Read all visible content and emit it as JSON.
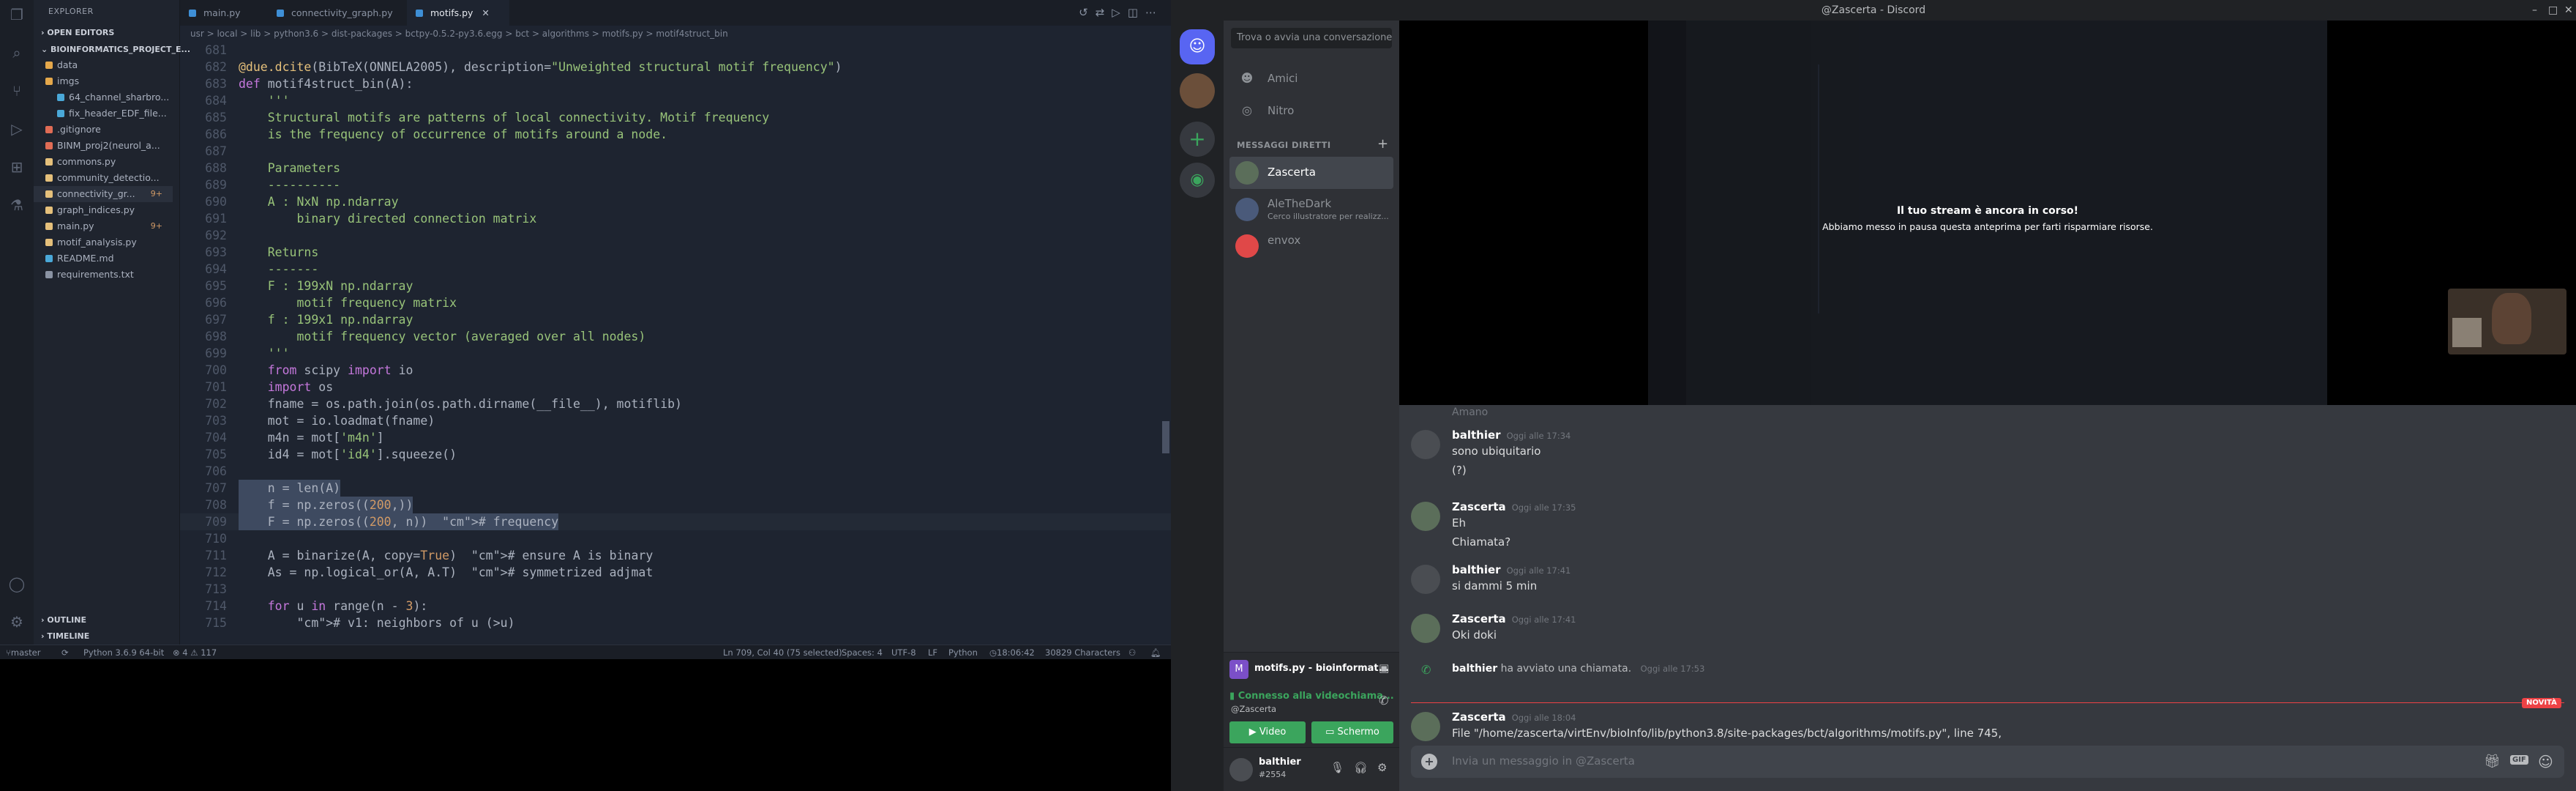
{
  "vscode": {
    "explorer_title": "EXPLORER",
    "open_editors": "OPEN EDITORS",
    "project": "BIOINFORMATICS_PROJECT_E...",
    "tree": [
      {
        "label": "data",
        "type": "folder",
        "color": "#e5a84b",
        "indent": 1,
        "badge": ""
      },
      {
        "label": "imgs",
        "type": "folder",
        "color": "#e5a84b",
        "indent": 1,
        "badge": ""
      },
      {
        "label": "64_channel_sharbro...",
        "type": "file",
        "color": "#4aa8d8",
        "indent": 2,
        "badge": ""
      },
      {
        "label": "fix_header_EDF_file...",
        "type": "file",
        "color": "#4aa8d8",
        "indent": 2,
        "badge": ""
      },
      {
        "label": ".gitignore",
        "type": "file",
        "color": "#e06c55",
        "indent": 1,
        "badge": ""
      },
      {
        "label": "BINM_proj2(neurol_a...",
        "type": "file",
        "color": "#e06c55",
        "indent": 1,
        "badge": ""
      },
      {
        "label": "commons.py",
        "type": "file",
        "color": "#e5c07b",
        "indent": 1,
        "badge": ""
      },
      {
        "label": "community_detectio...",
        "type": "file",
        "color": "#e5c07b",
        "indent": 1,
        "badge": ""
      },
      {
        "label": "connectivity_gr...",
        "type": "file",
        "color": "#e5c07b",
        "indent": 1,
        "badge": "9+",
        "sel": true
      },
      {
        "label": "graph_indices.py",
        "type": "file",
        "color": "#e5c07b",
        "indent": 1,
        "badge": ""
      },
      {
        "label": "main.py",
        "type": "file",
        "color": "#e5c07b",
        "indent": 1,
        "badge": "9+"
      },
      {
        "label": "motif_analysis.py",
        "type": "file",
        "color": "#e5c07b",
        "indent": 1,
        "badge": ""
      },
      {
        "label": "README.md",
        "type": "file",
        "color": "#4aa8d8",
        "indent": 1,
        "badge": ""
      },
      {
        "label": "requirements.txt",
        "type": "file",
        "color": "#8a93a3",
        "indent": 1,
        "badge": ""
      }
    ],
    "outline": "OUTLINE",
    "timeline": "TIMELINE",
    "tabs": [
      {
        "label": "main.py",
        "active": false
      },
      {
        "label": "connectivity_graph.py",
        "active": false
      },
      {
        "label": "motifs.py",
        "active": true
      }
    ],
    "breadcrumb": "usr > local > lib > python3.6 > dist-packages > bctpy-0.5.2-py3.6.egg > bct > algorithms > motifs.py > motif4struct_bin",
    "code_lines": [
      {
        "n": "681",
        "t": ""
      },
      {
        "n": "682",
        "t": "@due.dcite(BibTeX(ONNELA2005), description=\"Unweighted structural motif frequency\")"
      },
      {
        "n": "683",
        "t": "def motif4struct_bin(A):"
      },
      {
        "n": "684",
        "t": "    '''"
      },
      {
        "n": "685",
        "t": "    Structural motifs are patterns of local connectivity. Motif frequency"
      },
      {
        "n": "686",
        "t": "    is the frequency of occurrence of motifs around a node."
      },
      {
        "n": "687",
        "t": ""
      },
      {
        "n": "688",
        "t": "    Parameters"
      },
      {
        "n": "689",
        "t": "    ----------"
      },
      {
        "n": "690",
        "t": "    A : NxN np.ndarray"
      },
      {
        "n": "691",
        "t": "        binary directed connection matrix"
      },
      {
        "n": "692",
        "t": ""
      },
      {
        "n": "693",
        "t": "    Returns"
      },
      {
        "n": "694",
        "t": "    -------"
      },
      {
        "n": "695",
        "t": "    F : 199xN np.ndarray"
      },
      {
        "n": "696",
        "t": "        motif frequency matrix"
      },
      {
        "n": "697",
        "t": "    f : 199x1 np.ndarray"
      },
      {
        "n": "698",
        "t": "        motif frequency vector (averaged over all nodes)"
      },
      {
        "n": "699",
        "t": "    '''"
      },
      {
        "n": "700",
        "t": "    from scipy import io"
      },
      {
        "n": "701",
        "t": "    import os"
      },
      {
        "n": "702",
        "t": "    fname = os.path.join(os.path.dirname(__file__), motiflib)"
      },
      {
        "n": "703",
        "t": "    mot = io.loadmat(fname)"
      },
      {
        "n": "704",
        "t": "    m4n = mot['m4n']"
      },
      {
        "n": "705",
        "t": "    id4 = mot['id4'].squeeze()"
      },
      {
        "n": "706",
        "t": ""
      },
      {
        "n": "707",
        "t": "    n = len(A)"
      },
      {
        "n": "708",
        "t": "    f = np.zeros((200,))"
      },
      {
        "n": "709",
        "t": "    F = np.zeros((200, n))  # frequency"
      },
      {
        "n": "710",
        "t": ""
      },
      {
        "n": "711",
        "t": "    A = binarize(A, copy=True)  # ensure A is binary"
      },
      {
        "n": "712",
        "t": "    As = np.logical_or(A, A.T)  # symmetrized adjmat"
      },
      {
        "n": "713",
        "t": ""
      },
      {
        "n": "714",
        "t": "    for u in range(n - 3):"
      },
      {
        "n": "715",
        "t": "        # v1: neighbors of u (>u)"
      }
    ],
    "status": {
      "branch": "master",
      "python": "Python 3.6.9 64-bit",
      "problems": "⊗ 4  ⚠ 117",
      "position": "Ln 709, Col 40 (75 selected)",
      "spaces": "Spaces: 4",
      "encoding": "UTF-8",
      "eol": "LF",
      "language": "Python",
      "clock": "18:06:42",
      "chars": "30829 Characters"
    }
  },
  "discord": {
    "window_title": "@Zascerta - Discord",
    "search_placeholder": "Trova o avvia una conversazione",
    "nav": [
      {
        "label": "Amici",
        "icon": "friends-icon"
      },
      {
        "label": "Nitro",
        "icon": "nitro-icon"
      }
    ],
    "dm_heading": "MESSAGGI DIRETTI",
    "dms": [
      {
        "name": "Zascerta",
        "sub": "",
        "color": "#5b6e5a",
        "selected": true
      },
      {
        "name": "AleTheDark",
        "sub": "Cerco illustratore per realizz...",
        "color": "#4a5a7a"
      },
      {
        "name": "envox",
        "sub": "",
        "color": "#e04848"
      }
    ],
    "stream_status": "motifs.py - bioinformat...",
    "voice_connected": "Connesso alla videochiama...",
    "voice_channel": "@Zascerta",
    "video_btn": "Video",
    "screen_btn": "Schermo",
    "user": {
      "name": "balthier",
      "tag": "#2554"
    },
    "stream_overlay_title": "Il tuo stream è ancora in corso!",
    "stream_overlay_sub": "Abbiamo messo in pausa questa anteprima per farti risparmiare risorse.",
    "top_cut_text": "Amano",
    "messages": [
      {
        "author": "balthier",
        "time": "Oggi alle 17:34",
        "lines": [
          "sono ubiquitario",
          "(?)"
        ],
        "av": "#4a4d52"
      },
      {
        "author": "Zascerta",
        "time": "Oggi alle 17:35",
        "lines": [
          "Eh",
          "Chiamata?"
        ],
        "av": "#5b6e5a"
      },
      {
        "author": "balthier",
        "time": "Oggi alle 17:41",
        "lines": [
          "si dammi 5 min"
        ],
        "av": "#4a4d52"
      },
      {
        "author": "Zascerta",
        "time": "Oggi alle 17:41",
        "lines": [
          "Oki doki"
        ],
        "av": "#5b6e5a"
      }
    ],
    "system_call": {
      "author": "balthier",
      "text": "ha avviato una chiamata.",
      "time": "Oggi alle 17:53"
    },
    "new_label": "NOVITÀ",
    "last_message": {
      "author": "Zascerta",
      "time": "Oggi alle 18:04",
      "text": "File \"/home/zascerta/virtEnv/bioInfo/lib/python3.8/site-packages/bct/algorithms/motifs.py\", line 745,"
    },
    "composer_placeholder": "Invia un messaggio in @Zascerta",
    "composer_icons": [
      "gift-icon",
      "gif-icon",
      "emoji-icon"
    ]
  }
}
